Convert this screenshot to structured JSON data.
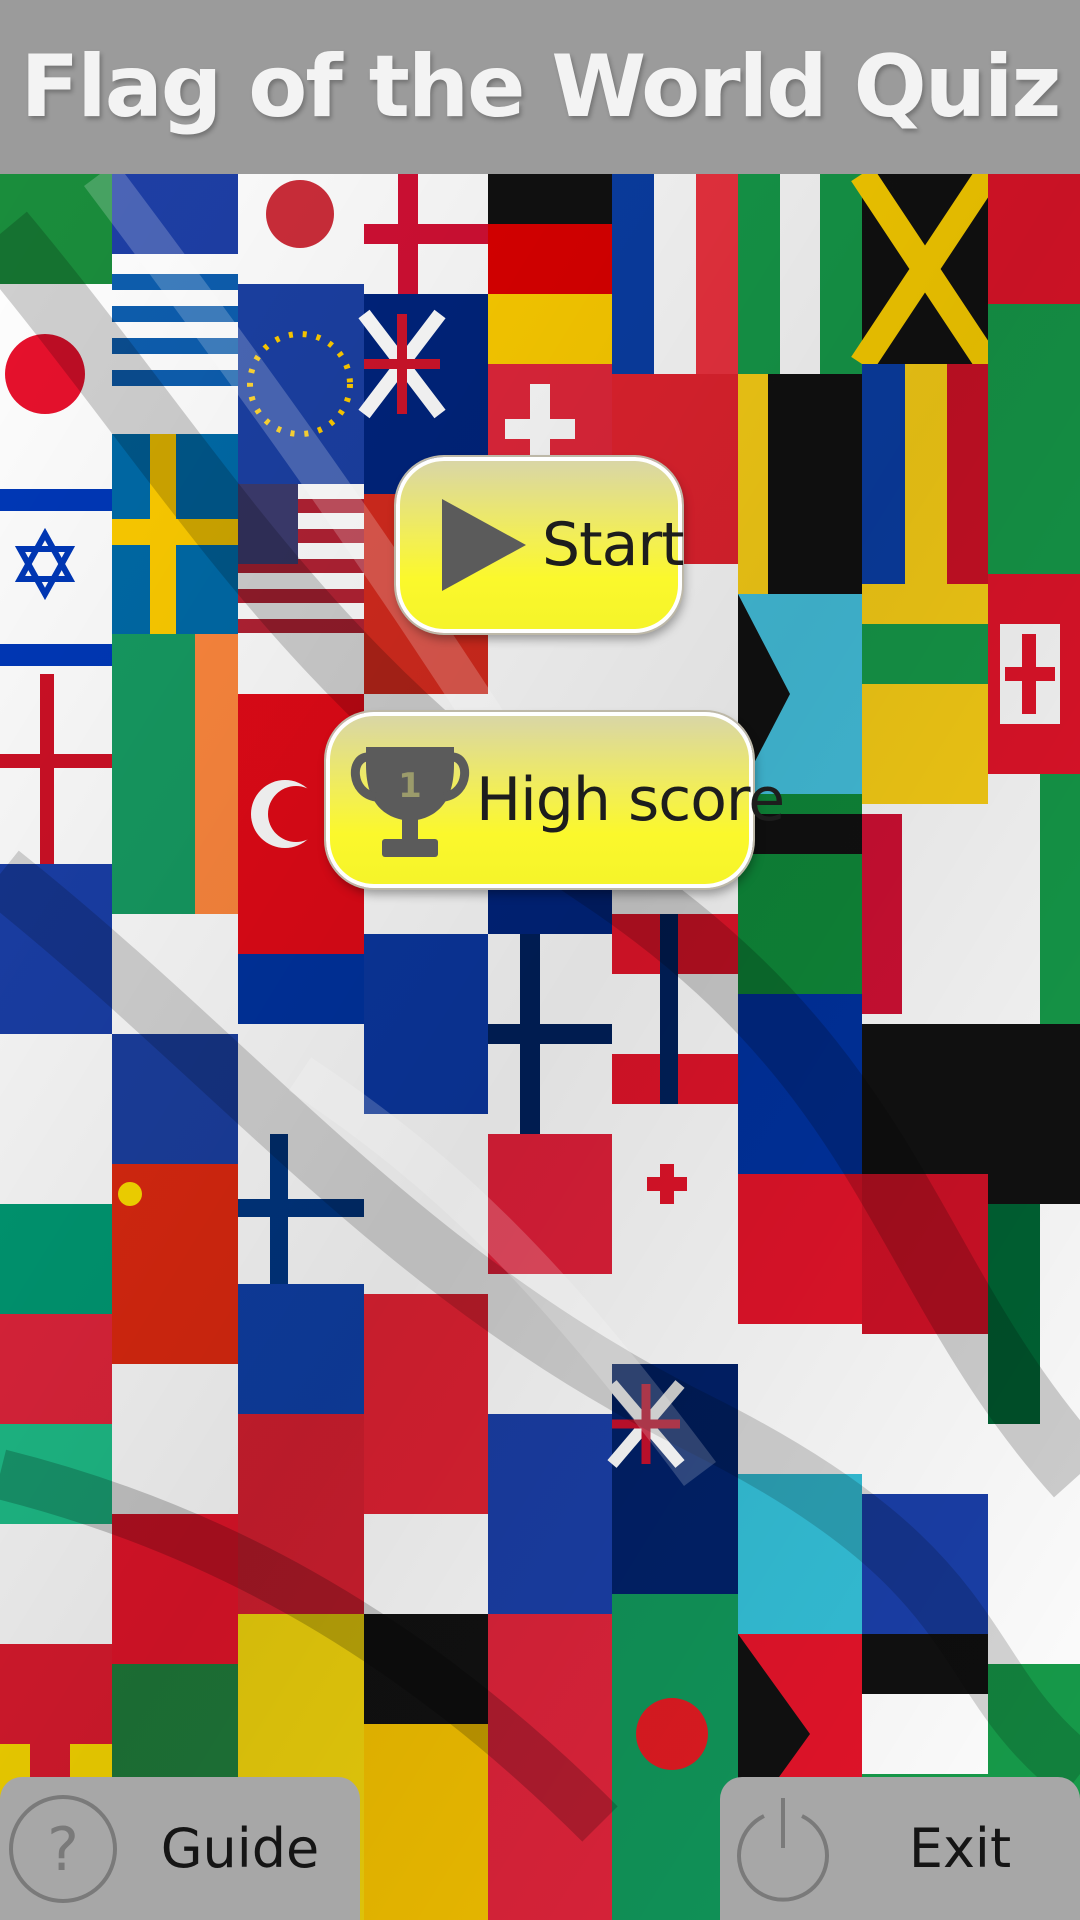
{
  "app": {
    "title": "Flag of the World Quiz"
  },
  "menu": {
    "start_label": "Start",
    "high_score_label": "High score",
    "trophy_number": "1"
  },
  "footer": {
    "guide_label": "Guide",
    "guide_icon_glyph": "?",
    "exit_label": "Exit"
  },
  "icons": {
    "play": "play-icon",
    "trophy": "trophy-icon",
    "help": "help-circle-icon",
    "power": "power-icon"
  },
  "colors": {
    "header_bg": "#9b9b9b",
    "title_text": "#f3f3f3",
    "button_yellow": "#fbf82c",
    "footer_bg": "#a7a7a7"
  }
}
